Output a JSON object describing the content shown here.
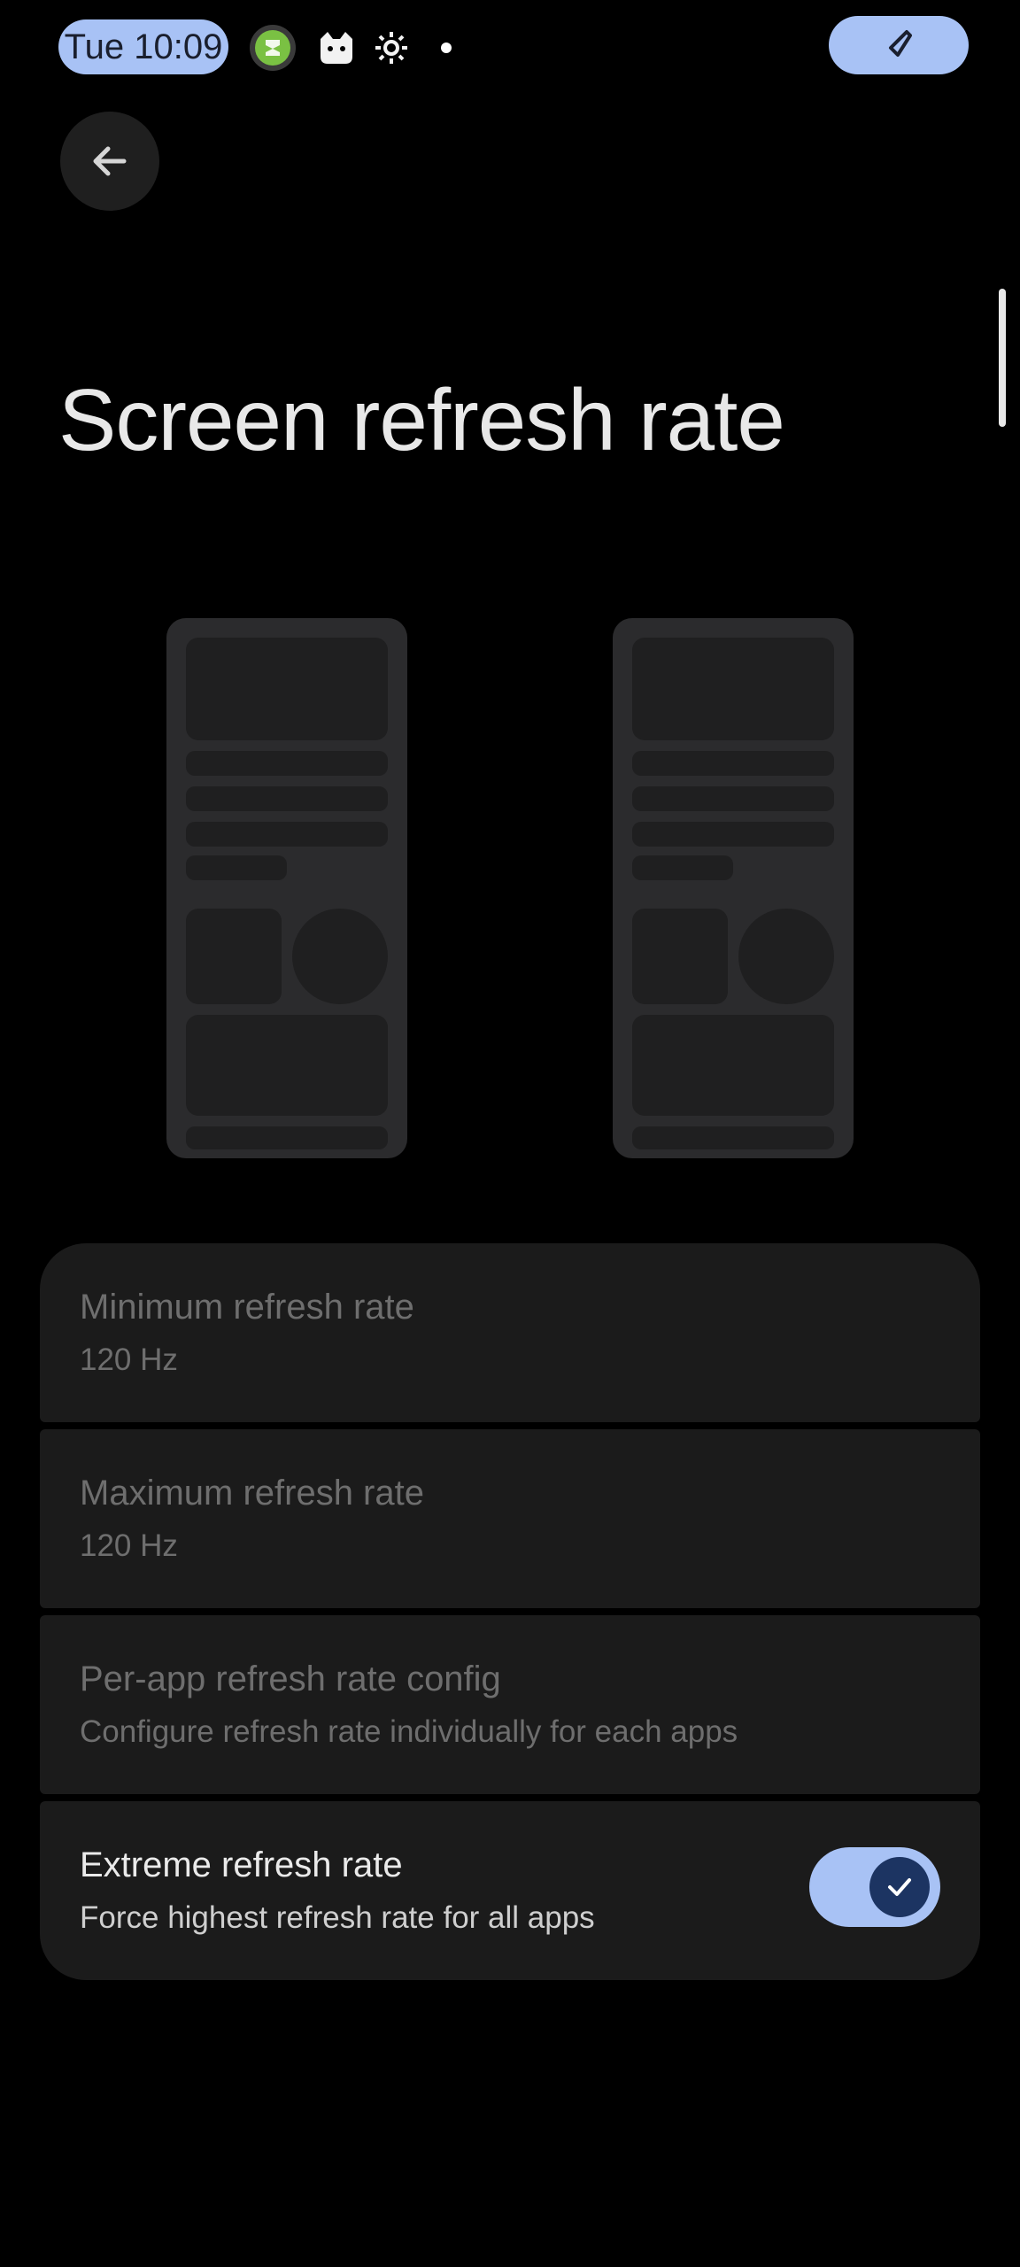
{
  "status_bar": {
    "time": "Tue 10:09",
    "icons": [
      "shield-app-icon",
      "cat-app-icon",
      "settings-gear-icon",
      "notification-dot"
    ],
    "call_indicator": "phone-call-icon"
  },
  "header": {
    "back_icon": "arrow-left-icon",
    "title": "Screen refresh rate"
  },
  "settings": [
    {
      "title": "Minimum refresh rate",
      "summary": "120 Hz",
      "enabled": false
    },
    {
      "title": "Maximum refresh rate",
      "summary": "120 Hz",
      "enabled": false
    },
    {
      "title": "Per-app refresh rate config",
      "summary": "Configure refresh rate individually for each apps",
      "enabled": false
    },
    {
      "title": "Extreme refresh rate",
      "summary": "Force highest refresh rate for all apps",
      "enabled": true,
      "toggle_on": true
    }
  ],
  "colors": {
    "accent": "#a8c2f5",
    "knob": "#1c3462",
    "card": "#1b1b1b",
    "background": "#000000"
  }
}
